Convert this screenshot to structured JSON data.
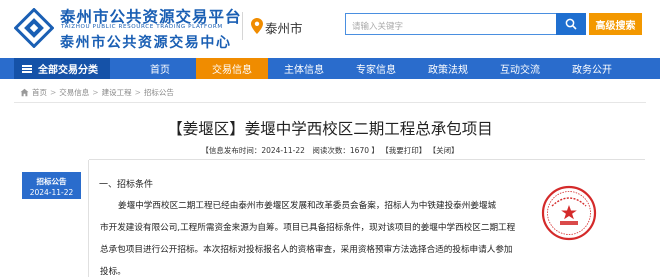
{
  "header": {
    "title": "泰州市公共资源交易平台",
    "title_en": "TAIZHOU PUBLIC RESOURCE TRADING PLATFORM",
    "subtitle": "泰州市公共资源交易中心",
    "location": "泰州市",
    "search_placeholder": "请输入关键字",
    "advanced_search": "高级搜索"
  },
  "nav": {
    "category": "全部交易分类",
    "items": [
      "首页",
      "交易信息",
      "主体信息",
      "专家信息",
      "政策法规",
      "互动交流",
      "政务公开"
    ],
    "active": "交易信息"
  },
  "breadcrumb": [
    "首页",
    "交易信息",
    "建设工程",
    "招标公告"
  ],
  "article": {
    "title": "【姜堰区】姜堰中学西校区二期工程总承包项目",
    "meta_info": "【信息发布时间：2024-11-22　阅读次数：1670 】",
    "meta_print": "【我要打印】",
    "meta_close": "【关闭】",
    "badge_label": "招标公告",
    "badge_date": "2024-11-22",
    "section_head": "一、招标条件",
    "para_line1": "姜堰中学西校区二期工程已经由泰州市姜堰区发展和改革委员会备案，招标人为中铁建投泰州姜堰城",
    "para_line2": "市开发建设有限公司,工程所需资金来源为自筹。项目已具备招标条件，现对该项目的姜堰中学西校区二期工程",
    "para_line3": "总承包项目进行公开招标。本次招标对投标报名人的资格审查，采用资格预审方法选择合适的投标申请人参加",
    "para_line4": "投标。"
  },
  "colors": {
    "brand_blue": "#1a5fb4",
    "nav_blue": "#2a6ccc",
    "active_orange": "#f08c00",
    "advanced_orange": "#f39800",
    "seal_red": "#d42a2a"
  },
  "icons": [
    "logo-icon",
    "location-pin-icon",
    "search-icon",
    "menu-icon",
    "home-icon",
    "seal-icon"
  ]
}
